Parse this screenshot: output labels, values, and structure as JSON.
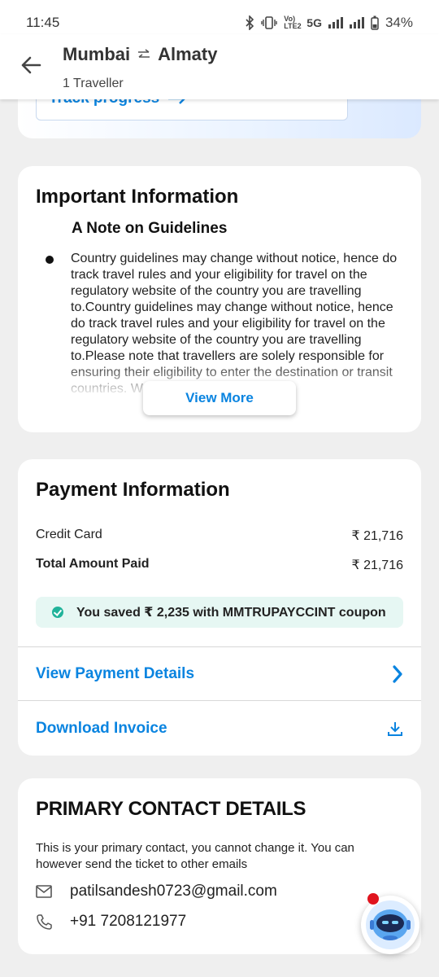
{
  "status": {
    "time": "11:45",
    "network_a": "Vo) LTE2",
    "network_b": "5G",
    "battery": "34%"
  },
  "header": {
    "origin": "Mumbai",
    "destination": "Almaty",
    "travellers": "1 Traveller"
  },
  "top_card": {
    "track_label": "Track progress"
  },
  "important": {
    "title": "Important Information",
    "subtitle": "A Note on Guidelines",
    "note": "Country guidelines may change without notice, hence do track travel rules and your eligibility for travel on the regulatory website of the country you are travelling to.Country guidelines may change without notice, hence do track travel rules and your eligibility for travel on the regulatory website of the country you are travelling to.Please note that travellers are solely responsible for ensuring their eligibility to enter the destination or transit countries. W... regard. Please",
    "view_more": "View More"
  },
  "payment": {
    "title": "Payment Information",
    "rows": [
      {
        "label": "Credit Card",
        "amount": "₹ 21,716"
      },
      {
        "label": "Total Amount Paid",
        "amount": "₹ 21,716"
      }
    ],
    "saved": "You saved ₹ 2,235 with MMTRUPAYCCINT coupon",
    "view_details": "View Payment Details",
    "download_invoice": "Download Invoice"
  },
  "contact": {
    "title": "PRIMARY CONTACT DETAILS",
    "description": "This is your primary contact, you cannot change it. You can however send the ticket to other emails",
    "email": "patilsandesh0723@gmail.com",
    "phone": "+91 7208121977"
  },
  "colors": {
    "link": "#0a84e0",
    "saved_bg": "#e6f7f3",
    "check": "#21b39a",
    "badge": "#e0141e"
  }
}
